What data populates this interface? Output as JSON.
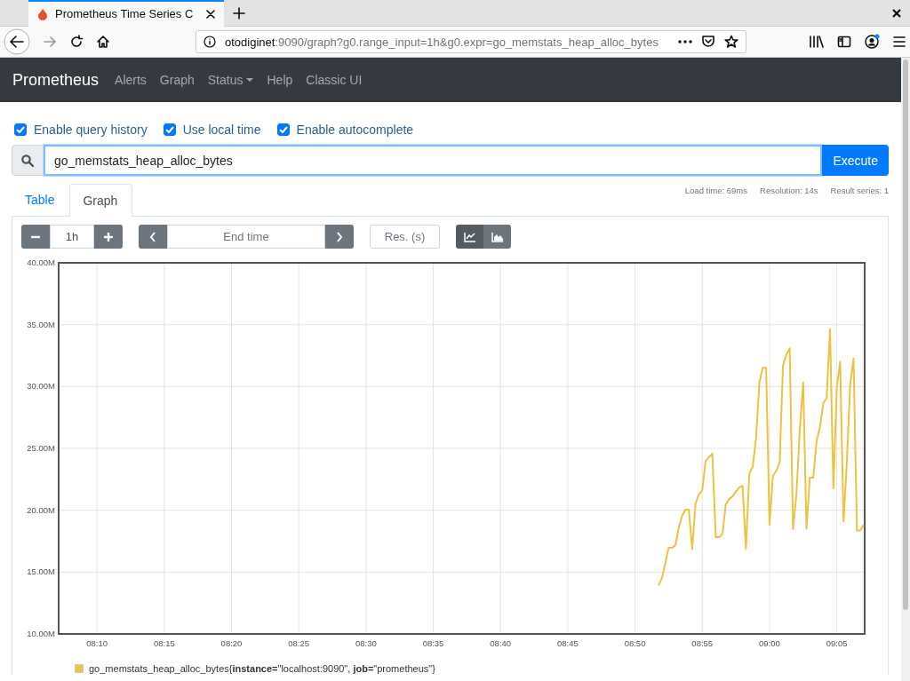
{
  "browser": {
    "tab_title": "Prometheus Time Series C",
    "url_host": "otodiginet",
    "url_path": ":9090/graph?g0.range_input=1h&g0.expr=go_memstats_heap_alloc_bytes"
  },
  "navbar": {
    "brand": "Prometheus",
    "items": [
      {
        "label": "Alerts",
        "dropdown": false
      },
      {
        "label": "Graph",
        "dropdown": false
      },
      {
        "label": "Status",
        "dropdown": true
      },
      {
        "label": "Help",
        "dropdown": false
      },
      {
        "label": "Classic UI",
        "dropdown": false
      }
    ]
  },
  "options": [
    {
      "label": "Enable query history",
      "checked": true
    },
    {
      "label": "Use local time",
      "checked": true
    },
    {
      "label": "Enable autocomplete",
      "checked": true
    }
  ],
  "query": {
    "value": "go_memstats_heap_alloc_bytes",
    "button": "Execute"
  },
  "stats": [
    "Load time: 69ms",
    "Resolution: 14s",
    "Result series: 1"
  ],
  "panel_tabs": [
    {
      "label": "Table",
      "selected": false
    },
    {
      "label": "Graph",
      "selected": true
    }
  ],
  "controls": {
    "range": "1h",
    "end_time_placeholder": "End time",
    "resolution_placeholder": "Res. (s)",
    "chart_modes": [
      {
        "kind": "lines",
        "selected": true
      },
      {
        "kind": "stacked",
        "selected": false
      }
    ]
  },
  "chart_data": {
    "type": "line",
    "grid": true,
    "ylim": [
      10,
      40
    ],
    "categories": [
      null,
      null,
      null,
      null,
      null,
      null,
      null,
      null,
      null,
      null,
      null,
      "08:10",
      null,
      null,
      null,
      null,
      null,
      null,
      null,
      null,
      null,
      null,
      null,
      null,
      null,
      null,
      null,
      null,
      null,
      null,
      null,
      "08:15",
      null,
      null,
      null,
      null,
      null,
      null,
      null,
      null,
      null,
      null,
      null,
      null,
      null,
      null,
      null,
      null,
      null,
      null,
      null,
      "08:20",
      null,
      null,
      null,
      null,
      null,
      null,
      null,
      null,
      null,
      null,
      null,
      null,
      null,
      null,
      null,
      null,
      null,
      null,
      null,
      "08:25",
      null,
      null,
      null,
      null,
      null,
      null,
      null,
      null,
      null,
      null,
      null,
      null,
      null,
      null,
      null,
      null,
      null,
      null,
      null,
      "08:30",
      null,
      null,
      null,
      null,
      null,
      null,
      null,
      null,
      null,
      null,
      null,
      null,
      null,
      null,
      null,
      null,
      null,
      null,
      null,
      "08:35",
      null,
      null,
      null,
      null,
      null,
      null,
      null,
      null,
      null,
      null,
      null,
      null,
      null,
      null,
      null,
      null,
      null,
      null,
      null,
      "08:40",
      null,
      null,
      null,
      null,
      null,
      null,
      null,
      null,
      null,
      null,
      null,
      null,
      null,
      null,
      null,
      null,
      null,
      null,
      null,
      "08:45",
      null,
      null,
      null,
      null,
      null,
      null,
      null,
      null,
      null,
      null,
      null,
      null,
      null,
      null,
      null,
      null,
      null,
      null,
      null,
      "08:50",
      null,
      null,
      null,
      null,
      null,
      null,
      null,
      null,
      null,
      null,
      null,
      null,
      null,
      null,
      null,
      null,
      null,
      null,
      null,
      "08:55",
      null,
      null,
      null,
      null,
      null,
      null,
      null,
      null,
      null,
      null,
      null,
      null,
      null,
      null,
      null,
      null,
      null,
      null,
      null,
      "09:00",
      null,
      null,
      null,
      null,
      null,
      null,
      null,
      null,
      null,
      null,
      null,
      null,
      null,
      null,
      null,
      null,
      null,
      null,
      null,
      "09:05",
      null,
      null,
      null,
      null,
      null,
      null,
      null,
      null
    ],
    "yticks": [
      {
        "value": 10,
        "label": "10.00M"
      },
      {
        "value": 15,
        "label": "15.00M"
      },
      {
        "value": 20,
        "label": "20.00M"
      },
      {
        "value": 25,
        "label": "25.00M"
      },
      {
        "value": 30,
        "label": "30.00M"
      },
      {
        "value": 35,
        "label": "35.00M"
      },
      {
        "value": 40,
        "label": "40.00M"
      }
    ],
    "series": [
      {
        "name": "go_memstats_heap_alloc_bytes{**instance=**\"localhost:9090\", **job=**\"prometheus\"}",
        "color": "#edc240",
        "values": [
          null,
          null,
          null,
          null,
          null,
          null,
          null,
          null,
          null,
          null,
          null,
          null,
          null,
          null,
          null,
          null,
          null,
          null,
          null,
          null,
          null,
          null,
          null,
          null,
          null,
          null,
          null,
          null,
          null,
          null,
          null,
          null,
          null,
          null,
          null,
          null,
          null,
          null,
          null,
          null,
          null,
          null,
          null,
          null,
          null,
          null,
          null,
          null,
          null,
          null,
          null,
          null,
          null,
          null,
          null,
          null,
          null,
          null,
          null,
          null,
          null,
          null,
          null,
          null,
          null,
          null,
          null,
          null,
          null,
          null,
          null,
          null,
          null,
          null,
          null,
          null,
          null,
          null,
          null,
          null,
          null,
          null,
          null,
          null,
          null,
          null,
          null,
          null,
          null,
          null,
          null,
          null,
          null,
          null,
          null,
          null,
          null,
          null,
          null,
          null,
          null,
          null,
          null,
          null,
          null,
          null,
          null,
          null,
          null,
          null,
          null,
          null,
          null,
          null,
          null,
          null,
          null,
          null,
          null,
          null,
          null,
          null,
          null,
          null,
          null,
          null,
          null,
          null,
          null,
          null,
          null,
          null,
          null,
          null,
          null,
          null,
          null,
          null,
          null,
          null,
          null,
          null,
          null,
          null,
          null,
          null,
          null,
          null,
          null,
          null,
          null,
          null,
          null,
          null,
          null,
          null,
          null,
          null,
          null,
          null,
          null,
          null,
          null,
          null,
          null,
          null,
          null,
          null,
          null,
          null,
          null,
          null,
          null,
          null,
          null,
          null,
          null,
          null,
          13.94,
          14.51,
          15.7,
          16.96,
          16.96,
          17.17,
          18.6,
          19.54,
          20.04,
          20.04,
          16.86,
          20.55,
          21.29,
          21.6,
          23.99,
          24.3,
          24.57,
          17.82,
          17.82,
          18.08,
          20.47,
          20.9,
          21.12,
          21.5,
          21.85,
          21.96,
          16.86,
          22.96,
          23.51,
          25.83,
          30.38,
          31.51,
          31.51,
          18.82,
          22.75,
          23.2,
          23.82,
          31.7,
          32.58,
          33.08,
          18.47,
          21.29,
          26.5,
          30.33,
          18.51,
          22.63,
          22.63,
          25.59,
          26.72,
          28.66,
          29.07,
          34.64,
          21.77,
          29.95,
          32.01,
          19.09,
          23.8,
          30.17,
          32.27,
          18.37,
          18.37,
          18.8
        ]
      }
    ]
  }
}
